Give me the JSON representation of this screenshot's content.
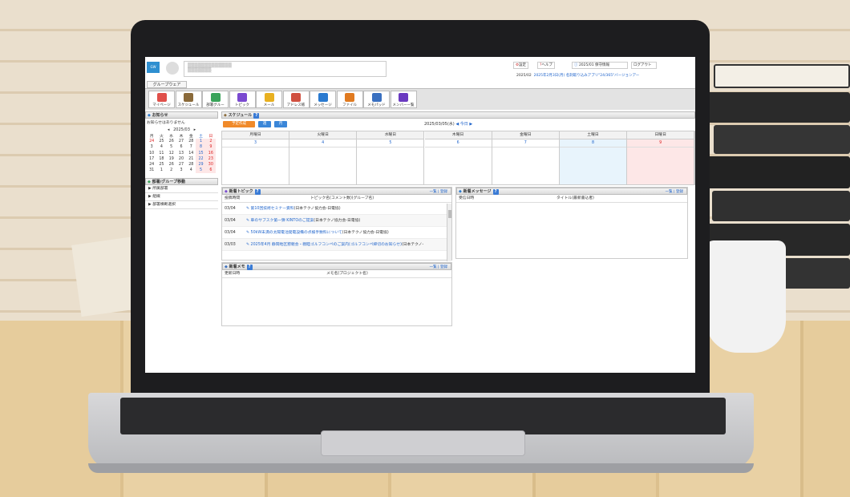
{
  "header": {
    "logo_text": "GW",
    "settings": "設定",
    "help": "ヘルプ",
    "maint": "2025/01 保守情報",
    "logout": "ログアウト",
    "notice_date": "2025/02",
    "notice_text": "2025年2月3日(月) 名刺取り込みアプリ\"24/365\"バージョンアー"
  },
  "tab": "グループウェア",
  "toolbar": [
    {
      "label": "マイページ",
      "icon": "home-icon",
      "color": "#e0504a"
    },
    {
      "label": "スケジュール",
      "icon": "calendar-icon",
      "color": "#8a6a3a"
    },
    {
      "label": "部署グルー",
      "icon": "group-icon",
      "color": "#3aa35a"
    },
    {
      "label": "トピック",
      "icon": "topic-icon",
      "color": "#7a4ad0"
    },
    {
      "label": "メール",
      "icon": "mail-icon",
      "color": "#e8b020"
    },
    {
      "label": "アドレス帳",
      "icon": "addressbook-icon",
      "color": "#d05040"
    },
    {
      "label": "メッセージ",
      "icon": "message-icon",
      "color": "#2a7ad0"
    },
    {
      "label": "ファイル",
      "icon": "file-icon",
      "color": "#e07a20"
    },
    {
      "label": "メモパッド",
      "icon": "memo-icon",
      "color": "#3a70c0"
    },
    {
      "label": "メンバー一覧",
      "icon": "members-icon",
      "color": "#6a3ac0"
    }
  ],
  "sidebar": {
    "notice_title": "お知らせ",
    "notice_empty": "お知らせはありません",
    "calendar_month": "2025/03",
    "weekdays": [
      "月",
      "火",
      "水",
      "木",
      "金",
      "土",
      "日"
    ],
    "weeks": [
      [
        "24",
        "25",
        "26",
        "27",
        "28",
        "1",
        "2"
      ],
      [
        "3",
        "4",
        "5",
        "6",
        "7",
        "8",
        "9"
      ],
      [
        "10",
        "11",
        "12",
        "13",
        "14",
        "15",
        "16"
      ],
      [
        "17",
        "18",
        "19",
        "20",
        "21",
        "22",
        "23"
      ],
      [
        "24",
        "25",
        "26",
        "27",
        "28",
        "29",
        "30"
      ],
      [
        "31",
        "1",
        "2",
        "3",
        "4",
        "5",
        "6"
      ]
    ],
    "dept_title": "部署/グループ移動",
    "dept_items": [
      "所属部署",
      "組織",
      "部署横断選択"
    ]
  },
  "schedule": {
    "title": "スケジュール",
    "btn_new": "予定作成",
    "btn_week": "週",
    "btn_month": "月",
    "date": "2025/03/05(水)",
    "today": "今日",
    "days": [
      {
        "name": "月曜日",
        "num": "3"
      },
      {
        "name": "火曜日",
        "num": "4"
      },
      {
        "name": "水曜日",
        "num": "5"
      },
      {
        "name": "木曜日",
        "num": "6"
      },
      {
        "name": "金曜日",
        "num": "7"
      },
      {
        "name": "土曜日",
        "num": "8"
      },
      {
        "name": "日曜日",
        "num": "9"
      }
    ]
  },
  "topics": {
    "title": "新着トピック",
    "links": "一覧 | 登録",
    "col1": "投稿時間",
    "col2": "トピック名(コメント数)(グループ名)",
    "rows": [
      {
        "date": "03/04",
        "title": "第10回技術セミナー資料",
        "group": "(日本テクノ協力会-日電協)"
      },
      {
        "date": "03/04",
        "title": "車のサブスク第一弾 KINTOのご提案",
        "group": "(日本テクノ協力会-日電協)"
      },
      {
        "date": "03/04",
        "title": "50kW未満の太陽電池発電設備の点検手数料について",
        "group": "(日本テクノ協力会-日電協)"
      },
      {
        "date": "03/03",
        "title": "2025年4月 静岡地区懇親会・親睦ゴルフコンペのご案内(ゴルフコンペ締切のお知らせ)",
        "group": "(日本テクノ-"
      }
    ]
  },
  "messages": {
    "title": "新着メッセージ",
    "links": "一覧 | 登録",
    "col1": "受信日時",
    "col2": "タイトル(最新書込者)"
  },
  "memo": {
    "title": "新着メモ",
    "links": "一覧 | 登録",
    "col1": "更新日時",
    "col2": "メモ名(プロジェクト名)"
  }
}
